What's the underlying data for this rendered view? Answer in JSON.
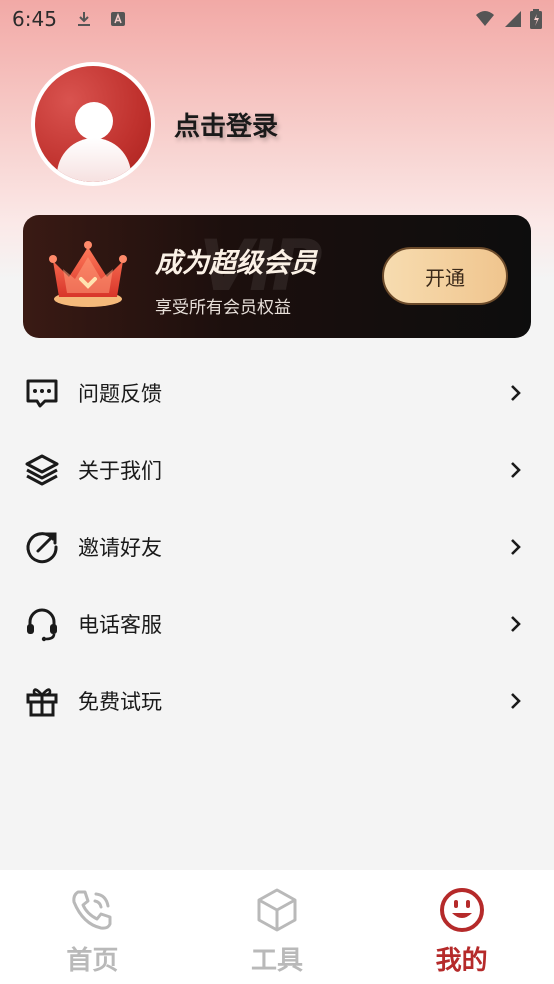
{
  "status_bar": {
    "time": "6:45",
    "icons_left": [
      "download-icon",
      "a-letter-icon"
    ],
    "icons_right": [
      "wifi-icon",
      "signal-icon",
      "battery-icon"
    ]
  },
  "profile": {
    "login_text": "点击登录"
  },
  "vip": {
    "watermark": "VIP",
    "title": "成为超级会员",
    "subtitle": "享受所有会员权益",
    "button_label": "开通"
  },
  "menu": [
    {
      "label": "问题反馈",
      "icon": "chat-icon"
    },
    {
      "label": "关于我们",
      "icon": "layers-icon"
    },
    {
      "label": "邀请好友",
      "icon": "share-arrow-icon"
    },
    {
      "label": "电话客服",
      "icon": "headset-icon"
    },
    {
      "label": "免费试玩",
      "icon": "gift-icon"
    }
  ],
  "tabs": [
    {
      "label": "首页",
      "icon": "phone-icon",
      "active": false
    },
    {
      "label": "工具",
      "icon": "cube-icon",
      "active": false
    },
    {
      "label": "我的",
      "icon": "smile-icon",
      "active": true
    }
  ],
  "colors": {
    "accent": "#b52a2a",
    "inactive": "#b9b9b9",
    "vip_button": "#f0c58e"
  }
}
